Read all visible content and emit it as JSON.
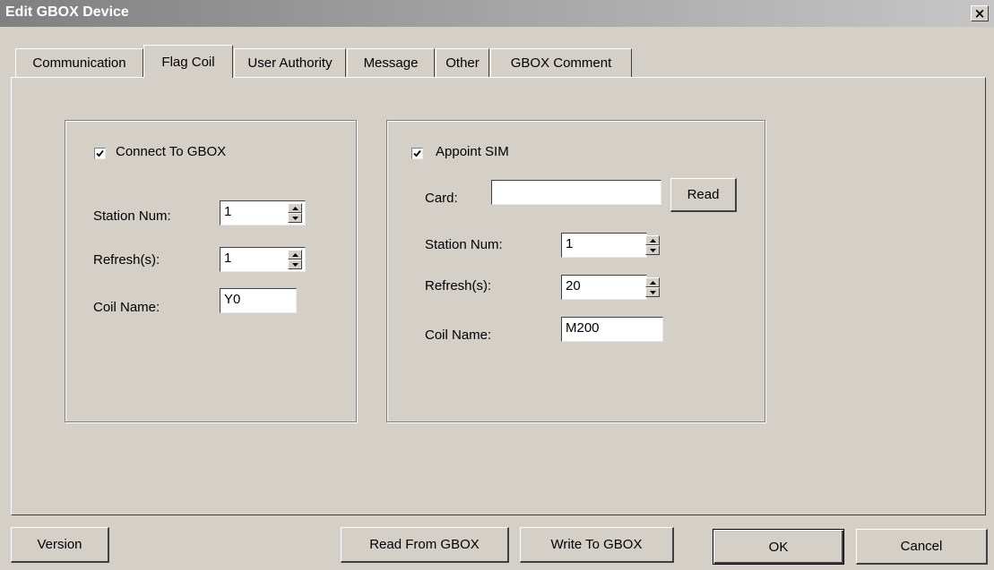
{
  "window": {
    "title": "Edit GBOX Device",
    "close_label": "×"
  },
  "tabs": [
    {
      "label": "Communication",
      "active": false
    },
    {
      "label": "Flag Coil",
      "active": true
    },
    {
      "label": "User Authority",
      "active": false
    },
    {
      "label": "Message",
      "active": false
    },
    {
      "label": "Other",
      "active": false
    },
    {
      "label": "GBOX Comment",
      "active": false
    }
  ],
  "left_group": {
    "checkbox_label": "Connect To GBOX",
    "checked": true,
    "station_num_label": "Station Num:",
    "station_num_value": "1",
    "refresh_label": "Refresh(s):",
    "refresh_value": "1",
    "coil_name_label": "Coil Name:",
    "coil_name_value": "Y0"
  },
  "right_group": {
    "checkbox_label": "Appoint SIM",
    "checked": true,
    "card_label": "Card:",
    "card_value": "",
    "read_button": "Read",
    "station_num_label": "Station Num:",
    "station_num_value": "1",
    "refresh_label": "Refresh(s):",
    "refresh_value": "20",
    "coil_name_label": "Coil Name:",
    "coil_name_value": "M200"
  },
  "footer": {
    "version_button": "Version",
    "read_from_button": "Read From GBOX",
    "write_to_button": "Write To GBOX",
    "ok_button": "OK",
    "cancel_button": "Cancel"
  }
}
